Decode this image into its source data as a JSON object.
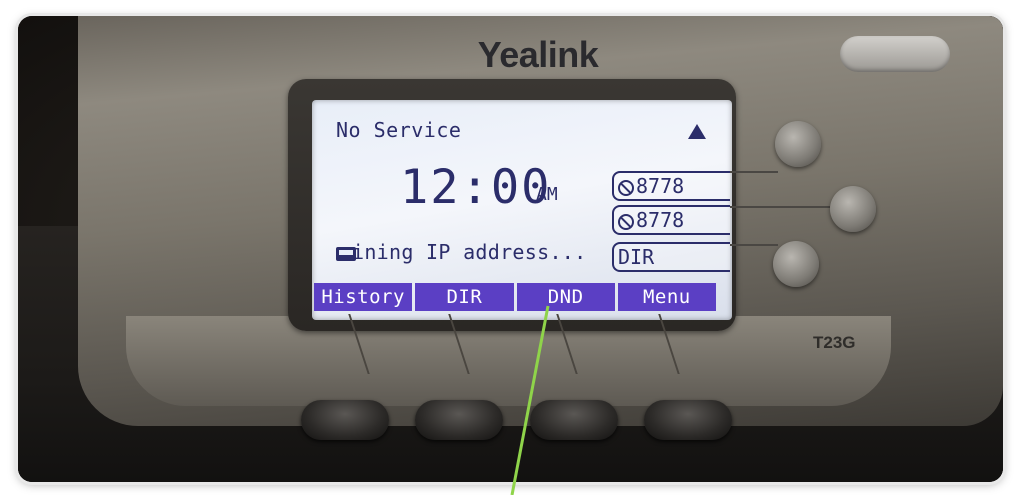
{
  "device": {
    "brand": "Yealink",
    "model": "T23G"
  },
  "screen": {
    "status": "No Service",
    "time": "12:00",
    "ampm": "AM",
    "ip_status": "ining IP address...",
    "line_keys": [
      {
        "label": "8778",
        "icon": "ban-icon"
      },
      {
        "label": "8778",
        "icon": "ban-icon"
      },
      {
        "label": "DIR",
        "icon": ""
      }
    ],
    "softkeys": [
      "History",
      "DIR",
      "DND",
      "Menu"
    ],
    "warning_icon": "warning-triangle-icon",
    "network_icon": "network-icon"
  },
  "colors": {
    "lcd_text": "#2b2d6a",
    "softkey_bg": "#5b3fc4",
    "annotation_arrow": "#8fd44a"
  }
}
